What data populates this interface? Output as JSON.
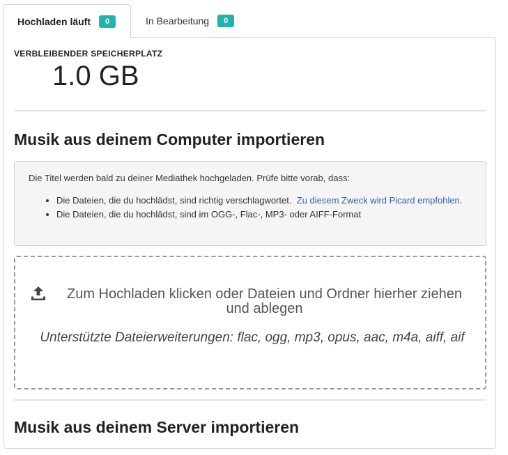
{
  "tabs": {
    "uploading": {
      "label": "Hochladen läuft",
      "count": "0"
    },
    "processing": {
      "label": "In Bearbeitung",
      "count": "0"
    }
  },
  "storage": {
    "label": "VERBLEIBENDER SPEICHERPLATZ",
    "value": "1.0 GB"
  },
  "computer_import": {
    "title": "Musik aus deinem Computer importieren",
    "info": {
      "intro": "Die Titel werden bald zu deiner Mediathek hochgeladen. Prüfe bitte vorab, dass:",
      "item1_text": "Die Dateien, die du hochlädst, sind richtig verschlagwortet.",
      "item1_link": "Zu diesem Zweck wird Picard empfohlen.",
      "item2_text": "Die Dateien, die du hochlädst, sind im OGG-, Flac-, MP3- oder AIFF-Format"
    },
    "dropzone": {
      "icon": "upload-icon",
      "text": "Zum Hochladen klicken oder Dateien und Ordner hierher ziehen und ablegen",
      "extensions": "Unterstützte Dateierweiterungen: flac, ogg, mp3, opus, aac, m4a, aiff, aif"
    }
  },
  "server_import": {
    "title": "Musik aus deinem Server importieren"
  },
  "colors": {
    "badge": "#1fb5ac",
    "link": "#2c5fb3",
    "info_background": "#f5f5f5",
    "dropzone_border": "#999999"
  }
}
